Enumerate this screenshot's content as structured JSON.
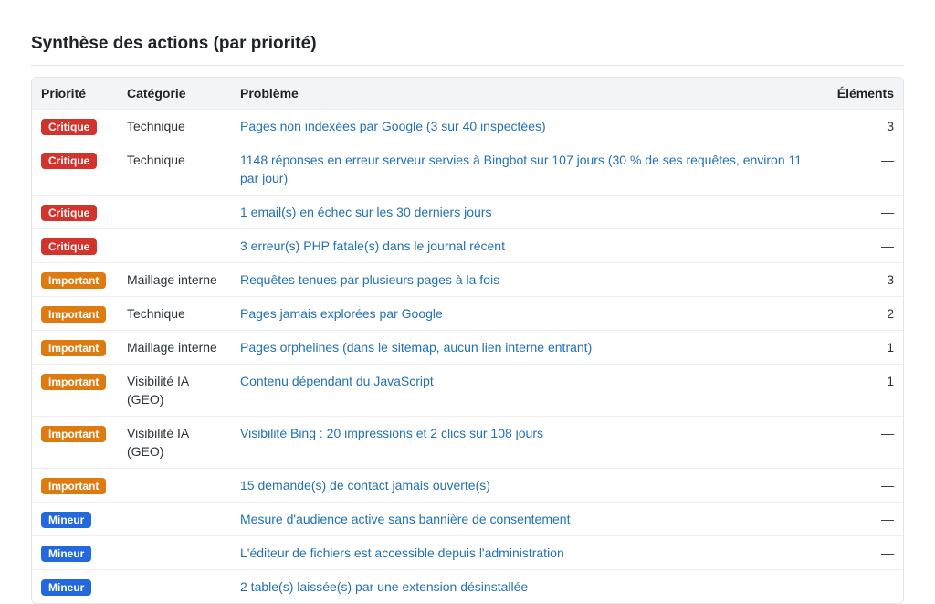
{
  "section": {
    "title": "Synthèse des actions (par priorité)"
  },
  "table": {
    "headers": {
      "priority": "Priorité",
      "category": "Catégorie",
      "problem": "Problème",
      "count": "Éléments"
    },
    "rows": [
      {
        "priority": "Critique",
        "level": "critique",
        "category": "Technique",
        "problem": "Pages non indexées par Google (3 sur 40 inspectées)",
        "count": "3"
      },
      {
        "priority": "Critique",
        "level": "critique",
        "category": "Technique",
        "problem": "1148 réponses en erreur serveur servies à Bingbot sur 107 jours (30 % de ses requêtes, environ 11 par jour)",
        "count": "—"
      },
      {
        "priority": "Critique",
        "level": "critique",
        "category": "",
        "problem": "1 email(s) en échec sur les 30 derniers jours",
        "count": "—"
      },
      {
        "priority": "Critique",
        "level": "critique",
        "category": "",
        "problem": "3 erreur(s) PHP fatale(s) dans le journal récent",
        "count": "—"
      },
      {
        "priority": "Important",
        "level": "important",
        "category": "Maillage interne",
        "problem": "Requêtes tenues par plusieurs pages à la fois",
        "count": "3"
      },
      {
        "priority": "Important",
        "level": "important",
        "category": "Technique",
        "problem": "Pages jamais explorées par Google",
        "count": "2"
      },
      {
        "priority": "Important",
        "level": "important",
        "category": "Maillage interne",
        "problem": "Pages orphelines (dans le sitemap, aucun lien interne entrant)",
        "count": "1"
      },
      {
        "priority": "Important",
        "level": "important",
        "category": "Visibilité IA (GEO)",
        "problem": "Contenu dépendant du JavaScript",
        "count": "1"
      },
      {
        "priority": "Important",
        "level": "important",
        "category": "Visibilité IA (GEO)",
        "problem": "Visibilité Bing : 20 impressions et 2 clics sur 108 jours",
        "count": "—"
      },
      {
        "priority": "Important",
        "level": "important",
        "category": "",
        "problem": "15 demande(s) de contact jamais ouverte(s)",
        "count": "—"
      },
      {
        "priority": "Mineur",
        "level": "mineur",
        "category": "",
        "problem": "Mesure d'audience active sans bannière de consentement",
        "count": "—"
      },
      {
        "priority": "Mineur",
        "level": "mineur",
        "category": "",
        "problem": "L'éditeur de fichiers est accessible depuis l'administration",
        "count": "—"
      },
      {
        "priority": "Mineur",
        "level": "mineur",
        "category": "",
        "problem": "2 table(s) laissée(s) par une extension désinstallée",
        "count": "—"
      }
    ]
  },
  "colors": {
    "critique": "#d0342c",
    "important": "#de7b10",
    "mineur": "#2368dd",
    "link": "#2271b1"
  }
}
